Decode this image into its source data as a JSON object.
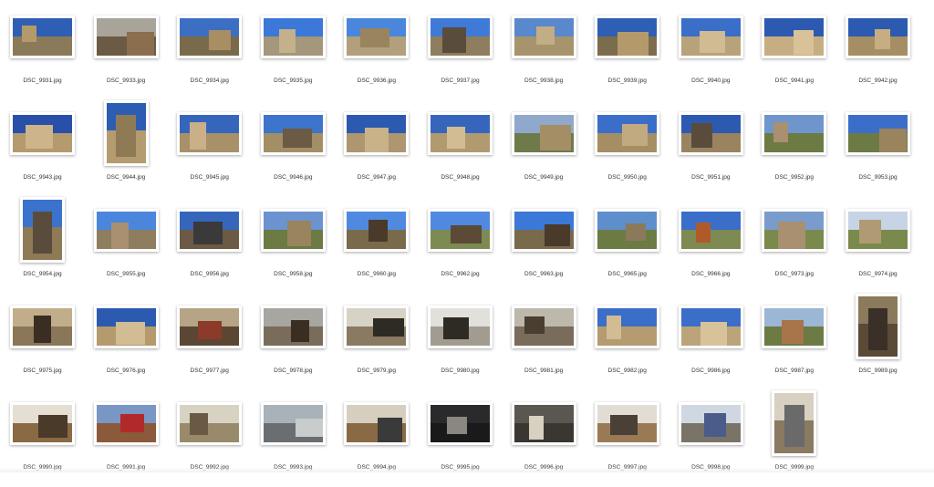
{
  "files": [
    {
      "name": "DSC_9931.jpg",
      "orientation": "land",
      "sky": "#2f5fb4",
      "ground": "#8a7a5a",
      "accent": "#b49a6a"
    },
    {
      "name": "DSC_9933.jpg",
      "orientation": "land",
      "sky": "#a8a49a",
      "ground": "#6b5a44",
      "accent": "#8b6e4d"
    },
    {
      "name": "DSC_9934.jpg",
      "orientation": "land",
      "sky": "#3c6fc4",
      "ground": "#7a6a4c",
      "accent": "#a88e62"
    },
    {
      "name": "DSC_9935.jpg",
      "orientation": "land",
      "sky": "#3b78d8",
      "ground": "#a4977b",
      "accent": "#c4b08a"
    },
    {
      "name": "DSC_9936.jpg",
      "orientation": "land",
      "sky": "#4a86dc",
      "ground": "#b29f7c",
      "accent": "#9a845e"
    },
    {
      "name": "DSC_9937.jpg",
      "orientation": "land",
      "sky": "#3f7ad6",
      "ground": "#8e7d5e",
      "accent": "#5a4c3c"
    },
    {
      "name": "DSC_9938.jpg",
      "orientation": "land",
      "sky": "#5a88cc",
      "ground": "#a8946c",
      "accent": "#c2ad84"
    },
    {
      "name": "DSC_9939.jpg",
      "orientation": "land",
      "sky": "#2f5fb4",
      "ground": "#7c6c4e",
      "accent": "#b49a6a"
    },
    {
      "name": "DSC_9940.jpg",
      "orientation": "land",
      "sky": "#3b6ec8",
      "ground": "#b8a27a",
      "accent": "#d0bb92"
    },
    {
      "name": "DSC_9941.jpg",
      "orientation": "land",
      "sky": "#2c5ab0",
      "ground": "#c7ae82",
      "accent": "#d9c298"
    },
    {
      "name": "DSC_9942.jpg",
      "orientation": "land",
      "sky": "#2c5ab0",
      "ground": "#a68e64",
      "accent": "#c7ae82"
    },
    {
      "name": "DSC_9943.jpg",
      "orientation": "land",
      "sky": "#2850a8",
      "ground": "#b49a6c",
      "accent": "#cdb48a"
    },
    {
      "name": "DSC_9944.jpg",
      "orientation": "port",
      "sky": "#2d5db2",
      "ground": "#b49c70",
      "accent": "#8f7a56"
    },
    {
      "name": "DSC_9945.jpg",
      "orientation": "land",
      "sky": "#3566bc",
      "ground": "#a89068",
      "accent": "#c9b089"
    },
    {
      "name": "DSC_9946.jpg",
      "orientation": "land",
      "sky": "#3d74cc",
      "ground": "#a48e66",
      "accent": "#6b5a44"
    },
    {
      "name": "DSC_9947.jpg",
      "orientation": "land",
      "sky": "#2c5ab0",
      "ground": "#ae9670",
      "accent": "#c8b28a"
    },
    {
      "name": "DSC_9948.jpg",
      "orientation": "land",
      "sky": "#3566bc",
      "ground": "#b29a70",
      "accent": "#d2bc94"
    },
    {
      "name": "DSC_9949.jpg",
      "orientation": "land",
      "sky": "#8fa8cc",
      "ground": "#6f7a4a",
      "accent": "#a48e66"
    },
    {
      "name": "DSC_9950.jpg",
      "orientation": "land",
      "sky": "#3b6ec8",
      "ground": "#a68e64",
      "accent": "#c2aa80"
    },
    {
      "name": "DSC_9951.jpg",
      "orientation": "land",
      "sky": "#2c5ab0",
      "ground": "#9a8460",
      "accent": "#5a4c3c"
    },
    {
      "name": "DSC_9952.jpg",
      "orientation": "land",
      "sky": "#6f96cc",
      "ground": "#6c7a44",
      "accent": "#a89070"
    },
    {
      "name": "DSC_9953.jpg",
      "orientation": "land",
      "sky": "#3b6ec8",
      "ground": "#6c7a44",
      "accent": "#9a845e"
    },
    {
      "name": "DSC_9954.jpg",
      "orientation": "port",
      "sky": "#3a72cc",
      "ground": "#8f7a56",
      "accent": "#5a4c3c"
    },
    {
      "name": "DSC_9955.jpg",
      "orientation": "land",
      "sky": "#4a86dc",
      "ground": "#8e7d5e",
      "accent": "#a89070"
    },
    {
      "name": "DSC_9956.jpg",
      "orientation": "land",
      "sky": "#3566bc",
      "ground": "#6b5a44",
      "accent": "#3a3a3a"
    },
    {
      "name": "DSC_9958.jpg",
      "orientation": "land",
      "sky": "#6a93d0",
      "ground": "#6c7a44",
      "accent": "#9a845e"
    },
    {
      "name": "DSC_9960.jpg",
      "orientation": "land",
      "sky": "#4f8ae0",
      "ground": "#7a6a4c",
      "accent": "#4a3a2a"
    },
    {
      "name": "DSC_9962.jpg",
      "orientation": "land",
      "sky": "#4f8ae0",
      "ground": "#7d8a52",
      "accent": "#5a4a36"
    },
    {
      "name": "DSC_9963.jpg",
      "orientation": "land",
      "sky": "#3b78d8",
      "ground": "#7a6a4c",
      "accent": "#4a3a2a"
    },
    {
      "name": "DSC_9965.jpg",
      "orientation": "land",
      "sky": "#5f8ecc",
      "ground": "#6c7a44",
      "accent": "#8a7a5a"
    },
    {
      "name": "DSC_9966.jpg",
      "orientation": "land",
      "sky": "#3b6ec8",
      "ground": "#7d8a52",
      "accent": "#b05a2c"
    },
    {
      "name": "DSC_9973.jpg",
      "orientation": "land",
      "sky": "#7a9ccc",
      "ground": "#7a8a4c",
      "accent": "#a89070"
    },
    {
      "name": "DSC_9974.jpg",
      "orientation": "land",
      "sky": "#c6d4e6",
      "ground": "#7a8a4c",
      "accent": "#b09a74"
    },
    {
      "name": "DSC_9975.jpg",
      "orientation": "land",
      "sky": "#c2ad8a",
      "ground": "#8a7658",
      "accent": "#3a2e22"
    },
    {
      "name": "DSC_9976.jpg",
      "orientation": "land",
      "sky": "#2c5ab0",
      "ground": "#b49a6c",
      "accent": "#d2bc94"
    },
    {
      "name": "DSC_9977.jpg",
      "orientation": "land",
      "sky": "#b6a486",
      "ground": "#5a4632",
      "accent": "#8c3a2a"
    },
    {
      "name": "DSC_9978.jpg",
      "orientation": "land",
      "sky": "#a8a6a0",
      "ground": "#7a6c5a",
      "accent": "#3a2e22"
    },
    {
      "name": "DSC_9979.jpg",
      "orientation": "land",
      "sky": "#d6d2c6",
      "ground": "#8a7a62",
      "accent": "#2e2a24"
    },
    {
      "name": "DSC_9980.jpg",
      "orientation": "land",
      "sky": "#e2e0da",
      "ground": "#a29c90",
      "accent": "#2e2a24"
    },
    {
      "name": "DSC_9981.jpg",
      "orientation": "land",
      "sky": "#bdb8ac",
      "ground": "#7a6c5a",
      "accent": "#4a3e30"
    },
    {
      "name": "DSC_9982.jpg",
      "orientation": "land",
      "sky": "#3b6ec8",
      "ground": "#b49c70",
      "accent": "#d2bc94"
    },
    {
      "name": "DSC_9986.jpg",
      "orientation": "land",
      "sky": "#3b6ec8",
      "ground": "#bca47a",
      "accent": "#d8c29a"
    },
    {
      "name": "DSC_9987.jpg",
      "orientation": "land",
      "sky": "#9cb6d6",
      "ground": "#6c7a44",
      "accent": "#a8744a"
    },
    {
      "name": "DSC_9989.jpg",
      "orientation": "port",
      "sky": "#8c7a5c",
      "ground": "#5a4a36",
      "accent": "#3a3028"
    },
    {
      "name": "DSC_9990.jpg",
      "orientation": "land",
      "sky": "#e4dfd2",
      "ground": "#8a6a44",
      "accent": "#4a3a2a"
    },
    {
      "name": "DSC_9991.jpg",
      "orientation": "land",
      "sky": "#7a96c4",
      "ground": "#8a5a3a",
      "accent": "#b02a2a"
    },
    {
      "name": "DSC_9992.jpg",
      "orientation": "land",
      "sky": "#d8d2c2",
      "ground": "#9a8a6c",
      "accent": "#6a5a44"
    },
    {
      "name": "DSC_9993.jpg",
      "orientation": "land",
      "sky": "#a8b2b8",
      "ground": "#6a6e70",
      "accent": "#c8cccc"
    },
    {
      "name": "DSC_9994.jpg",
      "orientation": "land",
      "sky": "#d6cfc0",
      "ground": "#8a6a44",
      "accent": "#3a3a3a"
    },
    {
      "name": "DSC_9995.jpg",
      "orientation": "land",
      "sky": "#2a2a2c",
      "ground": "#1a1a1a",
      "accent": "#8a8680"
    },
    {
      "name": "DSC_9996.jpg",
      "orientation": "land",
      "sky": "#5a5650",
      "ground": "#3a3632",
      "accent": "#d8d0c0"
    },
    {
      "name": "DSC_9997.jpg",
      "orientation": "land",
      "sky": "#e2ddd4",
      "ground": "#9a7a54",
      "accent": "#4a4036"
    },
    {
      "name": "DSC_9998.jpg",
      "orientation": "land",
      "sky": "#cfd8e0",
      "ground": "#7a7468",
      "accent": "#4a5c8a"
    },
    {
      "name": "DSC_9999.jpg",
      "orientation": "port",
      "sky": "#d8d0c0",
      "ground": "#8a7a62",
      "accent": "#6a6a6a"
    }
  ],
  "colors": {
    "background": "#ffffff",
    "label": "#333333",
    "frame": "#ffffff"
  }
}
